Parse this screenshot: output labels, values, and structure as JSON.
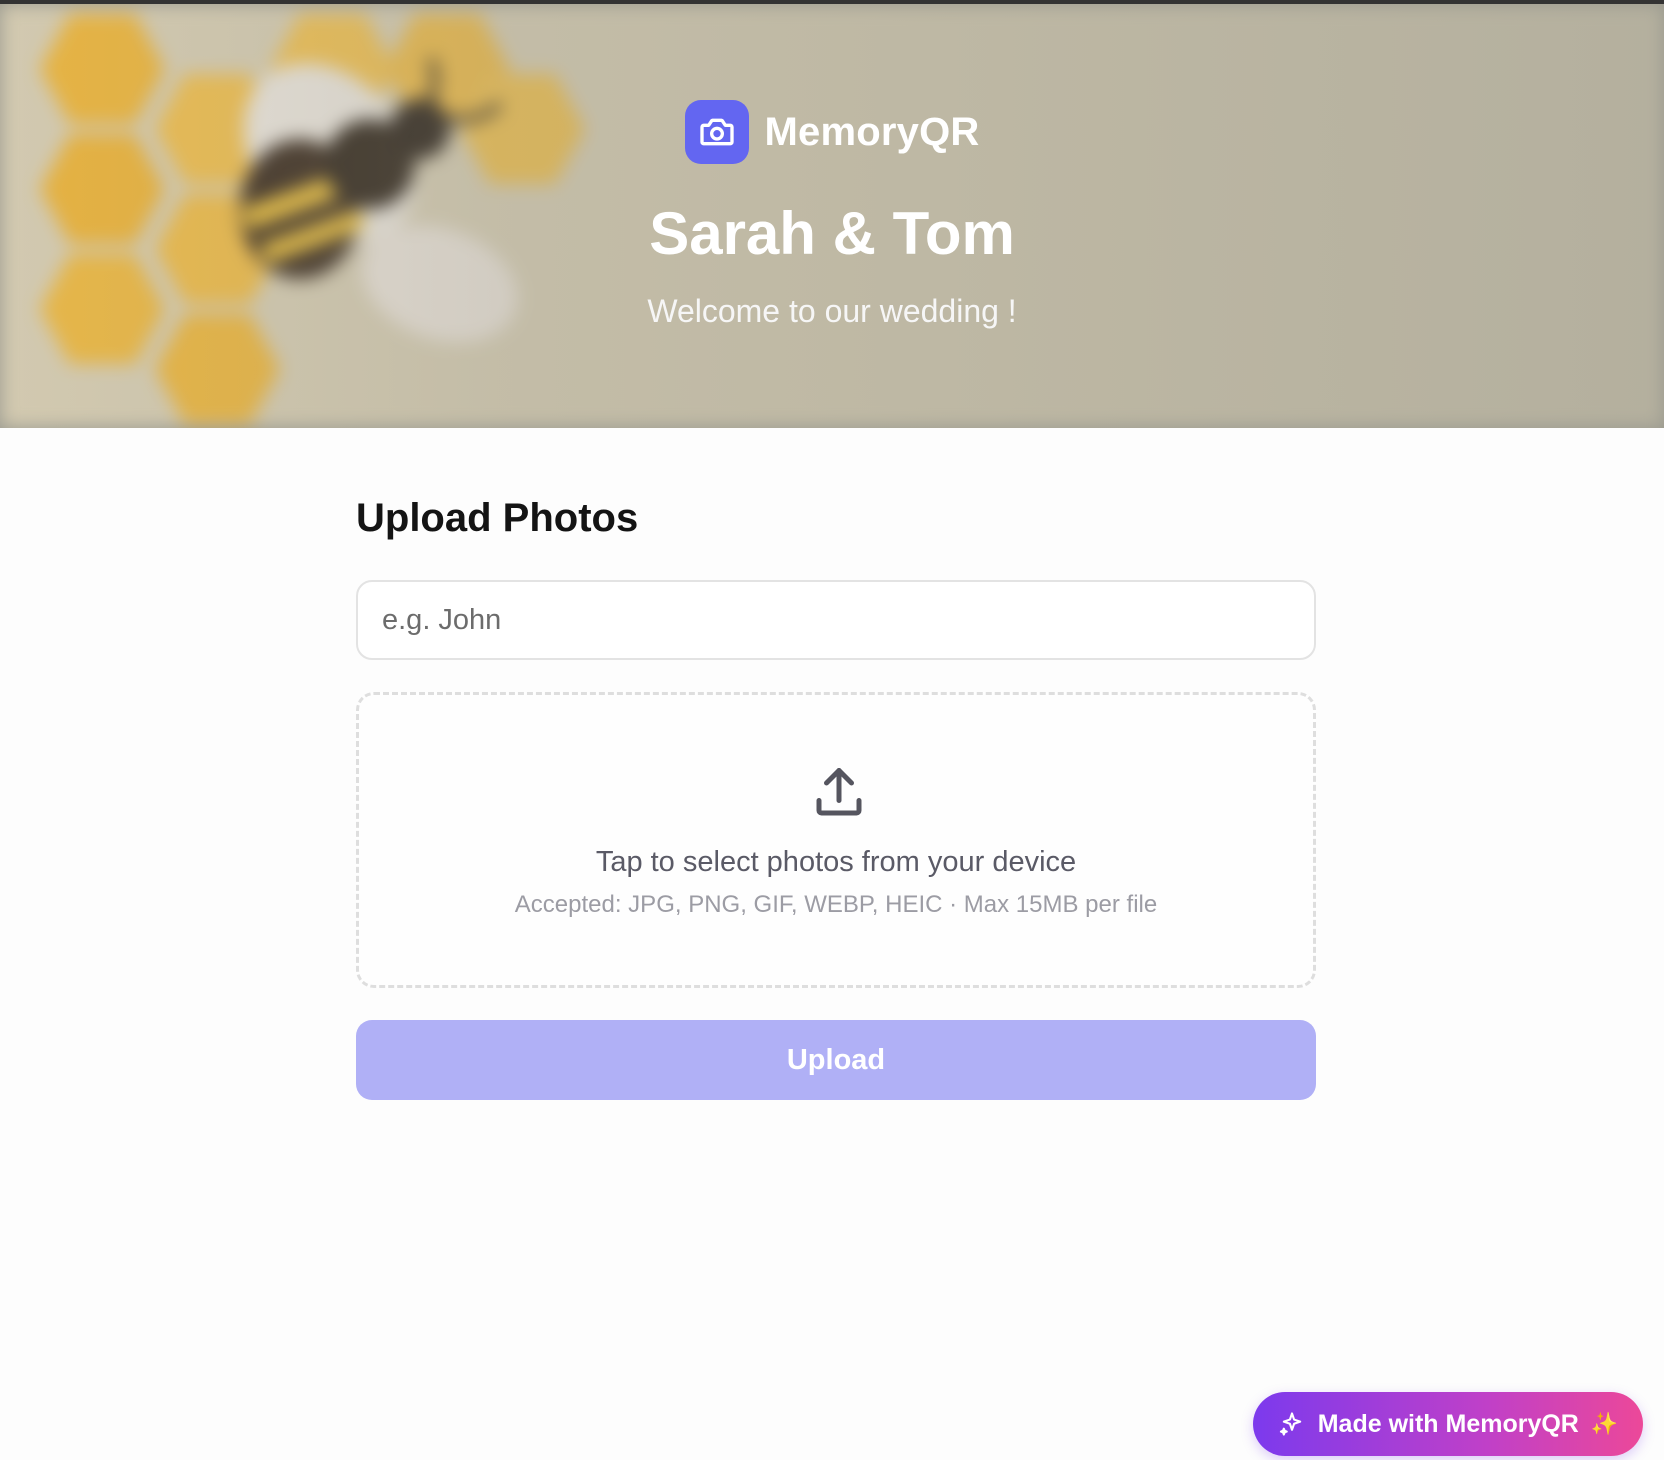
{
  "brand": {
    "name": "MemoryQR",
    "icon": "camera-icon",
    "accent": "#6366f1"
  },
  "event": {
    "title": "Sarah & Tom",
    "subtitle": "Welcome to our wedding !"
  },
  "upload_form": {
    "heading": "Upload Photos",
    "name_placeholder": "e.g. John",
    "name_value": "",
    "dropzone": {
      "icon": "upload-icon",
      "prompt": "Tap to select photos from your device",
      "hint": "Accepted: JPG, PNG, GIF, WEBP, HEIC · Max 15MB per file"
    },
    "submit_label": "Upload",
    "submit_color": "#b0b0f6"
  },
  "footer_badge": {
    "label": "Made with MemoryQR",
    "leading_icon": "sparkles-icon",
    "trailing_glyph": "✨"
  }
}
